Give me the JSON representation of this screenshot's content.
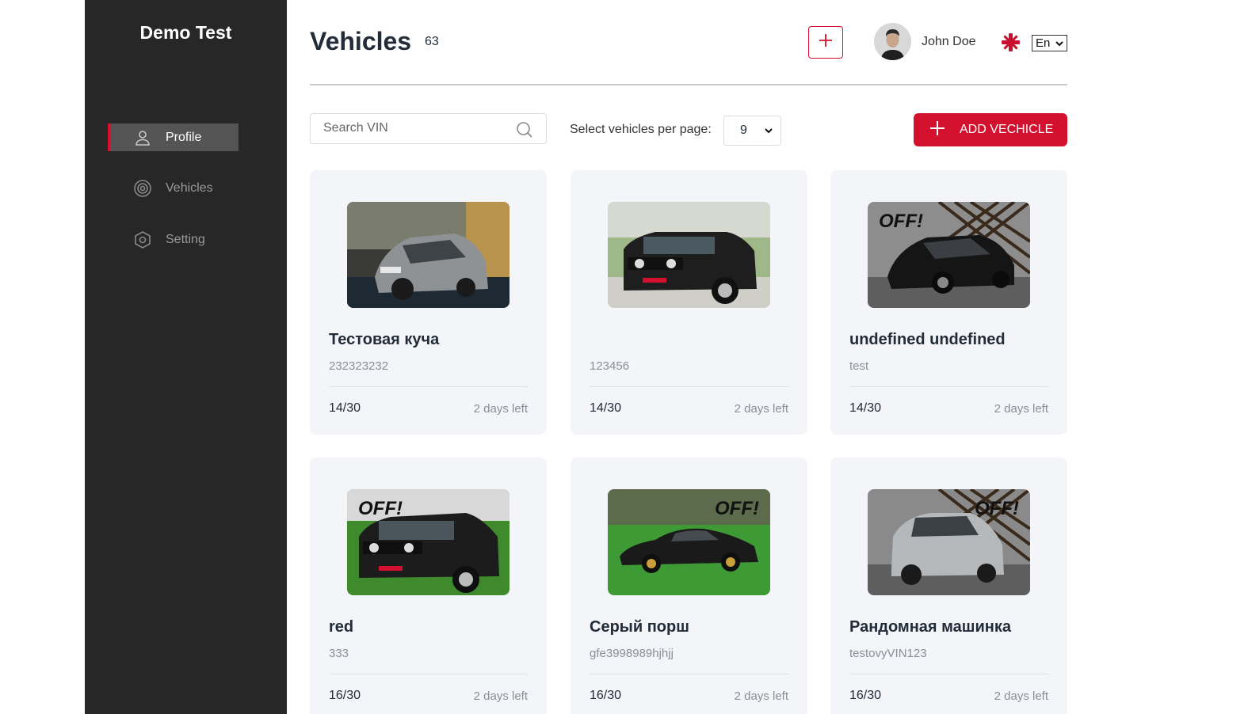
{
  "sidebar": {
    "brand": "Demo Test",
    "items": [
      {
        "label": "Profile",
        "icon": "user-icon",
        "active": true
      },
      {
        "label": "Vehicles",
        "icon": "target-icon",
        "active": false
      },
      {
        "label": "Setting",
        "icon": "hexagon-settings-icon",
        "active": false
      }
    ]
  },
  "header": {
    "title": "Vehicles",
    "count": "63",
    "user_name": "John Doe",
    "language": "En"
  },
  "toolbar": {
    "search_placeholder": "Search VIN",
    "per_page_label": "Select vehicles per page:",
    "per_page_value": "9",
    "add_label": "ADD VECHICLE"
  },
  "colors": {
    "accent": "#d3112e",
    "sidebar_bg": "#272727",
    "card_bg": "#f3f5f8"
  },
  "vehicles": [
    {
      "name": "Тестовая куча",
      "vin": "232323232",
      "progress": "14/30",
      "days": "2 days left",
      "photo": "grey-hatchback-showroom"
    },
    {
      "name": "",
      "vin": "123456",
      "progress": "14/30",
      "days": "2 days left",
      "photo": "black-suv-garden"
    },
    {
      "name": "undefined undefined",
      "vin": "test",
      "progress": "14/30",
      "days": "2 days left",
      "photo": "black-hatchback-offroad-studio"
    },
    {
      "name": "red",
      "vin": "333",
      "progress": "16/30",
      "days": "2 days left",
      "photo": "black-suv-grass"
    },
    {
      "name": "Серый порш",
      "vin": "gfe3998989hjhjj",
      "progress": "16/30",
      "days": "2 days left",
      "photo": "black-sportscar-grass"
    },
    {
      "name": "Рандомная машинка",
      "vin": "testovyVIN123",
      "progress": "16/30",
      "days": "2 days left",
      "photo": "silver-hatchback-studio"
    }
  ]
}
